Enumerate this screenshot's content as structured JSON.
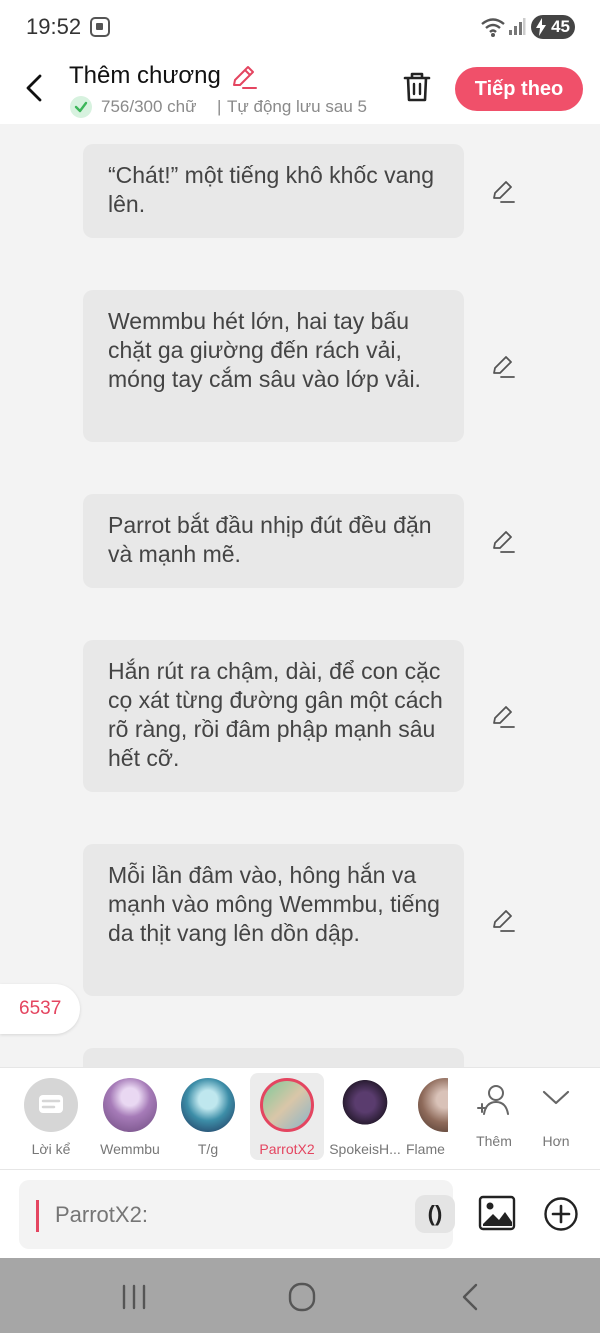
{
  "status_bar": {
    "time": "19:52",
    "battery": "45"
  },
  "header": {
    "title": "Thêm chương",
    "word_count": "756/300 chữ",
    "separator": "|",
    "autosave_text": "Tự động lưu sau 5",
    "next_label": "Tiếp theo"
  },
  "messages": [
    {
      "text": "“Chát!” một tiếng khô khốc vang lên."
    },
    {
      "text": "Wemmbu hét lớn, hai tay bấu chặt ga giường đến rách vải, móng tay cắm sâu vào lớp vải."
    },
    {
      "text": "Parrot bắt đầu nhịp đút đều đặn và mạnh mẽ."
    },
    {
      "text": "Hắn rút ra chậm, dài, để con cặc cọ xát từng đường gân một cách rõ ràng, rồi đâm phập mạnh sâu hết cỡ."
    },
    {
      "text": "Mỗi lần đâm vào, hông hắn va mạnh vào mông Wemmbu, tiếng da thịt vang lên dồn dập."
    }
  ],
  "word_counter": "6537",
  "characters": [
    {
      "label": "Lời kể"
    },
    {
      "label": "Wemmbu"
    },
    {
      "label": "T/g"
    },
    {
      "label": "ParrotX2"
    },
    {
      "label": "SpokeisH..."
    },
    {
      "label": "Flame"
    },
    {
      "label": "Thêm"
    },
    {
      "label": "Hơn"
    }
  ],
  "input": {
    "placeholder": "ParrotX2:",
    "paren_label": "()"
  },
  "colors": {
    "accent": "#f0506a",
    "accent_text": "#e44560",
    "bubble_bg": "#e8e8e8",
    "nav_bar": "#a6a6a6"
  }
}
